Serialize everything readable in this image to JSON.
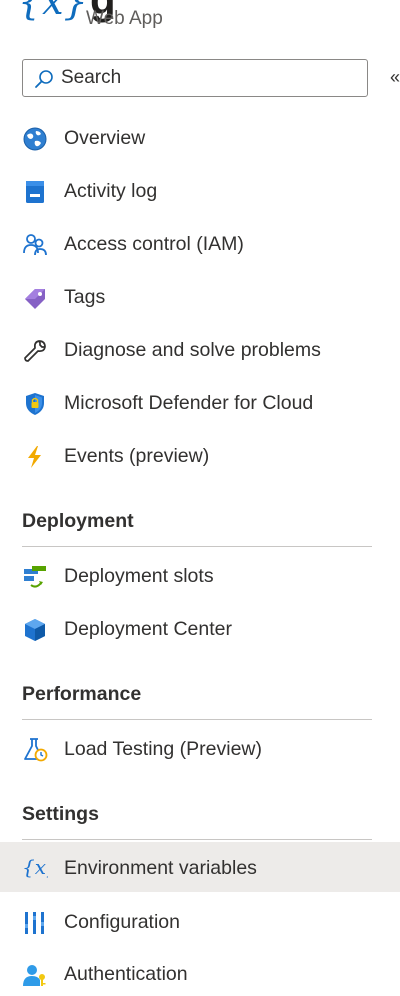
{
  "header": {
    "logo_text": "{x}",
    "title_fragment": "g",
    "subtitle": "Web App"
  },
  "search": {
    "placeholder": "Search",
    "collapse_glyph": "«"
  },
  "nav": {
    "top_items": [
      {
        "label": "Overview",
        "icon": "globe-icon"
      },
      {
        "label": "Activity log",
        "icon": "activity-log-icon"
      },
      {
        "label": "Access control (IAM)",
        "icon": "users-icon"
      },
      {
        "label": "Tags",
        "icon": "tag-icon"
      },
      {
        "label": "Diagnose and solve problems",
        "icon": "wrench-icon"
      },
      {
        "label": "Microsoft Defender for Cloud",
        "icon": "shield-icon"
      },
      {
        "label": "Events (preview)",
        "icon": "lightning-icon"
      }
    ],
    "sections": [
      {
        "title": "Deployment",
        "items": [
          {
            "label": "Deployment slots",
            "icon": "deployment-slots-icon"
          },
          {
            "label": "Deployment Center",
            "icon": "cube-icon"
          }
        ]
      },
      {
        "title": "Performance",
        "items": [
          {
            "label": "Load Testing (Preview)",
            "icon": "flask-clock-icon"
          }
        ]
      },
      {
        "title": "Settings",
        "items": [
          {
            "label": "Environment variables",
            "icon": "variable-icon",
            "selected": true
          },
          {
            "label": "Configuration",
            "icon": "config-bars-icon"
          },
          {
            "label": "Authentication",
            "icon": "user-key-icon"
          }
        ]
      }
    ]
  },
  "colors": {
    "accent": "#0f6cbd",
    "selected_bg": "#edebe9",
    "divider": "#c8c6c4",
    "text": "#323130"
  }
}
